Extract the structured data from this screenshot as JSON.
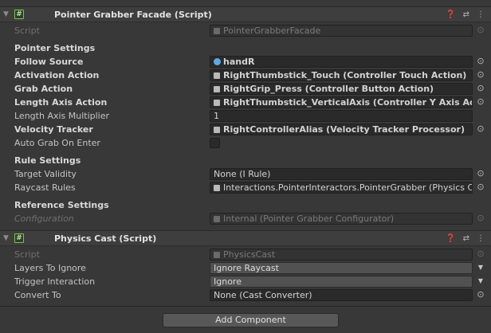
{
  "components": [
    {
      "title": "Pointer Grabber Facade (Script)",
      "script_label": "Script",
      "script_value": "PointerGrabberFacade",
      "sections": [
        {
          "title": "Pointer Settings",
          "fields": [
            {
              "label": "Follow Source",
              "value": "handR"
            },
            {
              "label": "Activation Action",
              "value": "RightThumbstick_Touch (Controller Touch Action)"
            },
            {
              "label": "Grab Action",
              "value": "RightGrip_Press (Controller Button Action)"
            },
            {
              "label": "Length Axis Action",
              "value": "RightThumbstick_VerticalAxis (Controller Y Axis Actior"
            },
            {
              "label": "Length Axis Multiplier",
              "value": "1"
            },
            {
              "label": "Velocity Tracker",
              "value": "RightControllerAlias (Velocity Tracker Processor)"
            },
            {
              "label": "Auto Grab On Enter",
              "value": "unchecked"
            }
          ]
        },
        {
          "title": "Rule Settings",
          "fields": [
            {
              "label": "Target Validity",
              "value": "None (I Rule)"
            },
            {
              "label": "Raycast Rules",
              "value": "Interactions.PointerInteractors.PointerGrabber (Physics C:"
            }
          ]
        },
        {
          "title": "Reference Settings",
          "fields": [
            {
              "label": "Configuration",
              "value": "Internal (Pointer Grabber Configurator)"
            }
          ]
        }
      ]
    },
    {
      "title": "Physics Cast (Script)",
      "script_label": "Script",
      "script_value": "PhysicsCast",
      "fields": [
        {
          "label": "Layers To Ignore",
          "value": "Ignore Raycast"
        },
        {
          "label": "Trigger Interaction",
          "value": "Ignore"
        },
        {
          "label": "Convert To",
          "value": "None (Cast Converter)"
        }
      ]
    }
  ],
  "add_component_label": "Add Component",
  "header_icons": {
    "help": "help-icon",
    "presets": "presets-icon",
    "menu": "kebab-menu-icon"
  },
  "colors": {
    "background": "#383838",
    "field": "#2a2a2a",
    "dropdown": "#515151",
    "script_icon": "#7fbf5a"
  }
}
